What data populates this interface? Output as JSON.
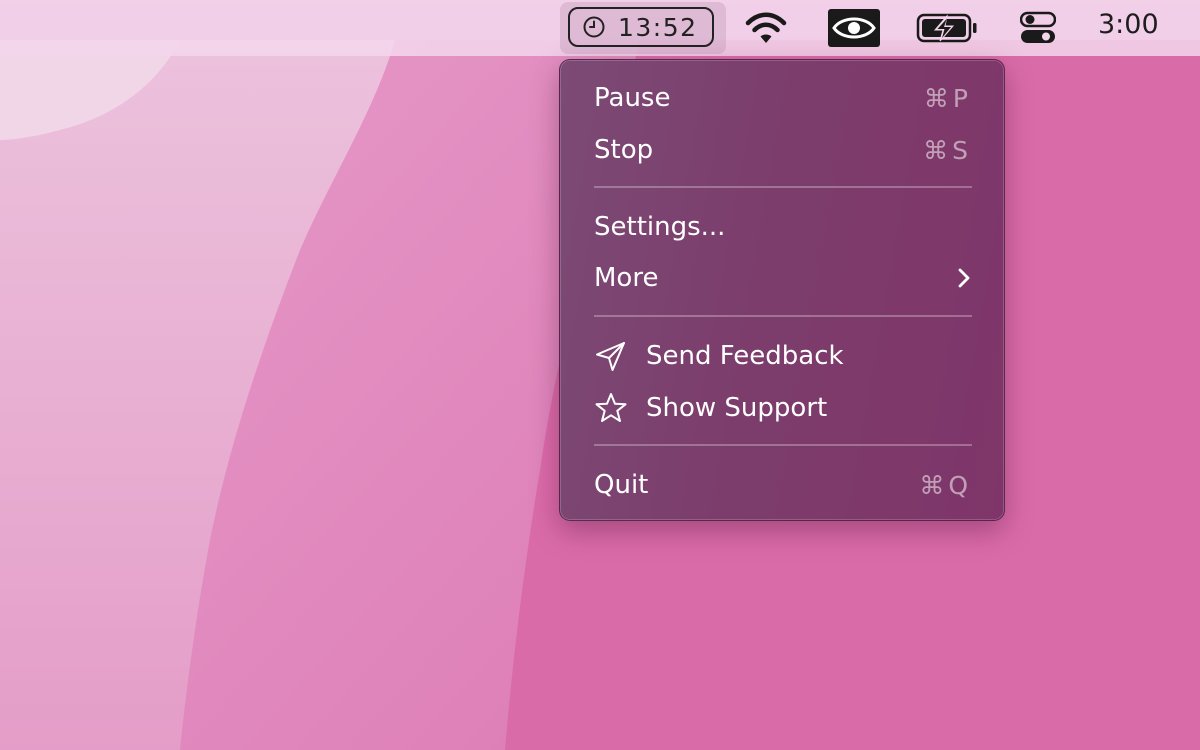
{
  "menubar": {
    "timer": {
      "time": "13:52",
      "icon": "timer-clock-icon"
    },
    "status_icons": [
      "wifi-icon",
      "eye-icon",
      "battery-charging-icon",
      "control-center-icon"
    ],
    "clock": "3:00"
  },
  "menu": {
    "items": [
      {
        "label": "Pause",
        "shortcut": "⌘P"
      },
      {
        "label": "Stop",
        "shortcut": "⌘S"
      },
      {
        "label": "Settings..."
      },
      {
        "label": "More",
        "icon": "chevron-right-icon"
      },
      {
        "label": "Send Feedback",
        "icon": "paper-plane-icon"
      },
      {
        "label": "Show Support",
        "icon": "star-icon"
      },
      {
        "label": "Quit",
        "shortcut": "⌘Q"
      }
    ]
  },
  "colors": {
    "menu_background": "#7c3d6c",
    "menubar_background": "#f3d6ec",
    "wallpaper": "#db6fac"
  }
}
